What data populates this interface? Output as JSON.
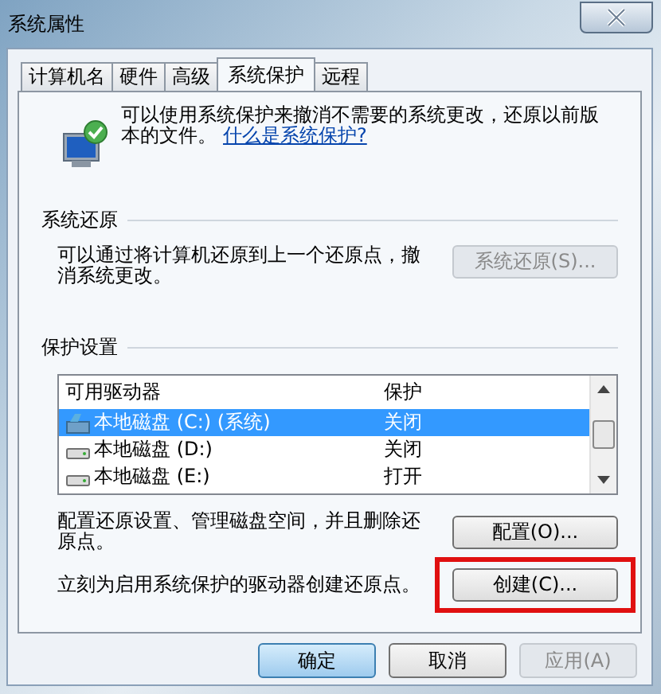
{
  "window": {
    "title": "系统属性"
  },
  "tabs": [
    {
      "label": "计算机名",
      "selected": false
    },
    {
      "label": "硬件",
      "selected": false
    },
    {
      "label": "高级",
      "selected": false
    },
    {
      "label": "系统保护",
      "selected": true
    },
    {
      "label": "远程",
      "selected": false
    }
  ],
  "intro": {
    "text": "可以使用系统保护来撤消不需要的系统更改，还原以前版本的文件。",
    "link": "什么是系统保护?"
  },
  "system_restore": {
    "heading": "系统还原",
    "text": "可以通过将计算机还原到上一个还原点，撤消系统更改。",
    "button": {
      "label": "系统还原(S)...",
      "disabled": true,
      "highlighted": false
    }
  },
  "protection": {
    "heading": "保护设置",
    "columns": [
      "可用驱动器",
      "保护"
    ],
    "rows": [
      {
        "kind": "system",
        "drive": "本地磁盘 (C:) (系统)",
        "protection": "关闭",
        "selected": true
      },
      {
        "kind": "disk",
        "drive": "本地磁盘 (D:)",
        "protection": "关闭",
        "selected": false
      },
      {
        "kind": "disk",
        "drive": "本地磁盘 (E:)",
        "protection": "打开",
        "selected": false
      }
    ],
    "actions": [
      {
        "text": "配置还原设置、管理磁盘空间，并且删除还原点。",
        "button": {
          "label": "配置(O)...",
          "disabled": false,
          "highlighted": false
        }
      },
      {
        "text": "立刻为启用系统保护的驱动器创建还原点。",
        "button": {
          "label": "创建(C)...",
          "disabled": false,
          "highlighted": true
        }
      }
    ]
  },
  "buttons": [
    {
      "label": "确定",
      "disabled": false,
      "default": true
    },
    {
      "label": "取消",
      "disabled": false,
      "default": false
    },
    {
      "label": "应用(A)",
      "disabled": true,
      "default": false
    }
  ]
}
